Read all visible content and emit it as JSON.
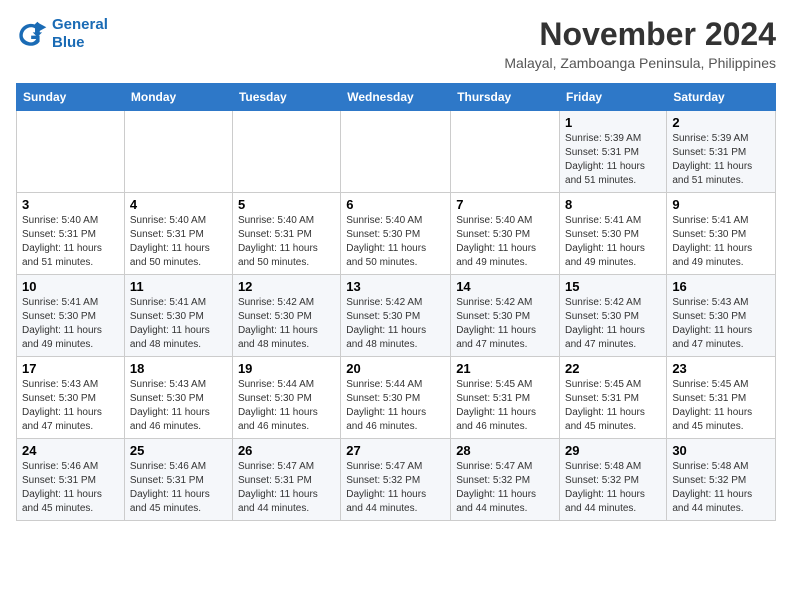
{
  "header": {
    "logo_line1": "General",
    "logo_line2": "Blue",
    "main_title": "November 2024",
    "subtitle": "Malayal, Zamboanga Peninsula, Philippines"
  },
  "days_of_week": [
    "Sunday",
    "Monday",
    "Tuesday",
    "Wednesday",
    "Thursday",
    "Friday",
    "Saturday"
  ],
  "weeks": [
    [
      {
        "day": "",
        "info": ""
      },
      {
        "day": "",
        "info": ""
      },
      {
        "day": "",
        "info": ""
      },
      {
        "day": "",
        "info": ""
      },
      {
        "day": "",
        "info": ""
      },
      {
        "day": "1",
        "info": "Sunrise: 5:39 AM\nSunset: 5:31 PM\nDaylight: 11 hours and 51 minutes."
      },
      {
        "day": "2",
        "info": "Sunrise: 5:39 AM\nSunset: 5:31 PM\nDaylight: 11 hours and 51 minutes."
      }
    ],
    [
      {
        "day": "3",
        "info": "Sunrise: 5:40 AM\nSunset: 5:31 PM\nDaylight: 11 hours and 51 minutes."
      },
      {
        "day": "4",
        "info": "Sunrise: 5:40 AM\nSunset: 5:31 PM\nDaylight: 11 hours and 50 minutes."
      },
      {
        "day": "5",
        "info": "Sunrise: 5:40 AM\nSunset: 5:31 PM\nDaylight: 11 hours and 50 minutes."
      },
      {
        "day": "6",
        "info": "Sunrise: 5:40 AM\nSunset: 5:30 PM\nDaylight: 11 hours and 50 minutes."
      },
      {
        "day": "7",
        "info": "Sunrise: 5:40 AM\nSunset: 5:30 PM\nDaylight: 11 hours and 49 minutes."
      },
      {
        "day": "8",
        "info": "Sunrise: 5:41 AM\nSunset: 5:30 PM\nDaylight: 11 hours and 49 minutes."
      },
      {
        "day": "9",
        "info": "Sunrise: 5:41 AM\nSunset: 5:30 PM\nDaylight: 11 hours and 49 minutes."
      }
    ],
    [
      {
        "day": "10",
        "info": "Sunrise: 5:41 AM\nSunset: 5:30 PM\nDaylight: 11 hours and 49 minutes."
      },
      {
        "day": "11",
        "info": "Sunrise: 5:41 AM\nSunset: 5:30 PM\nDaylight: 11 hours and 48 minutes."
      },
      {
        "day": "12",
        "info": "Sunrise: 5:42 AM\nSunset: 5:30 PM\nDaylight: 11 hours and 48 minutes."
      },
      {
        "day": "13",
        "info": "Sunrise: 5:42 AM\nSunset: 5:30 PM\nDaylight: 11 hours and 48 minutes."
      },
      {
        "day": "14",
        "info": "Sunrise: 5:42 AM\nSunset: 5:30 PM\nDaylight: 11 hours and 47 minutes."
      },
      {
        "day": "15",
        "info": "Sunrise: 5:42 AM\nSunset: 5:30 PM\nDaylight: 11 hours and 47 minutes."
      },
      {
        "day": "16",
        "info": "Sunrise: 5:43 AM\nSunset: 5:30 PM\nDaylight: 11 hours and 47 minutes."
      }
    ],
    [
      {
        "day": "17",
        "info": "Sunrise: 5:43 AM\nSunset: 5:30 PM\nDaylight: 11 hours and 47 minutes."
      },
      {
        "day": "18",
        "info": "Sunrise: 5:43 AM\nSunset: 5:30 PM\nDaylight: 11 hours and 46 minutes."
      },
      {
        "day": "19",
        "info": "Sunrise: 5:44 AM\nSunset: 5:30 PM\nDaylight: 11 hours and 46 minutes."
      },
      {
        "day": "20",
        "info": "Sunrise: 5:44 AM\nSunset: 5:30 PM\nDaylight: 11 hours and 46 minutes."
      },
      {
        "day": "21",
        "info": "Sunrise: 5:45 AM\nSunset: 5:31 PM\nDaylight: 11 hours and 46 minutes."
      },
      {
        "day": "22",
        "info": "Sunrise: 5:45 AM\nSunset: 5:31 PM\nDaylight: 11 hours and 45 minutes."
      },
      {
        "day": "23",
        "info": "Sunrise: 5:45 AM\nSunset: 5:31 PM\nDaylight: 11 hours and 45 minutes."
      }
    ],
    [
      {
        "day": "24",
        "info": "Sunrise: 5:46 AM\nSunset: 5:31 PM\nDaylight: 11 hours and 45 minutes."
      },
      {
        "day": "25",
        "info": "Sunrise: 5:46 AM\nSunset: 5:31 PM\nDaylight: 11 hours and 45 minutes."
      },
      {
        "day": "26",
        "info": "Sunrise: 5:47 AM\nSunset: 5:31 PM\nDaylight: 11 hours and 44 minutes."
      },
      {
        "day": "27",
        "info": "Sunrise: 5:47 AM\nSunset: 5:32 PM\nDaylight: 11 hours and 44 minutes."
      },
      {
        "day": "28",
        "info": "Sunrise: 5:47 AM\nSunset: 5:32 PM\nDaylight: 11 hours and 44 minutes."
      },
      {
        "day": "29",
        "info": "Sunrise: 5:48 AM\nSunset: 5:32 PM\nDaylight: 11 hours and 44 minutes."
      },
      {
        "day": "30",
        "info": "Sunrise: 5:48 AM\nSunset: 5:32 PM\nDaylight: 11 hours and 44 minutes."
      }
    ]
  ]
}
